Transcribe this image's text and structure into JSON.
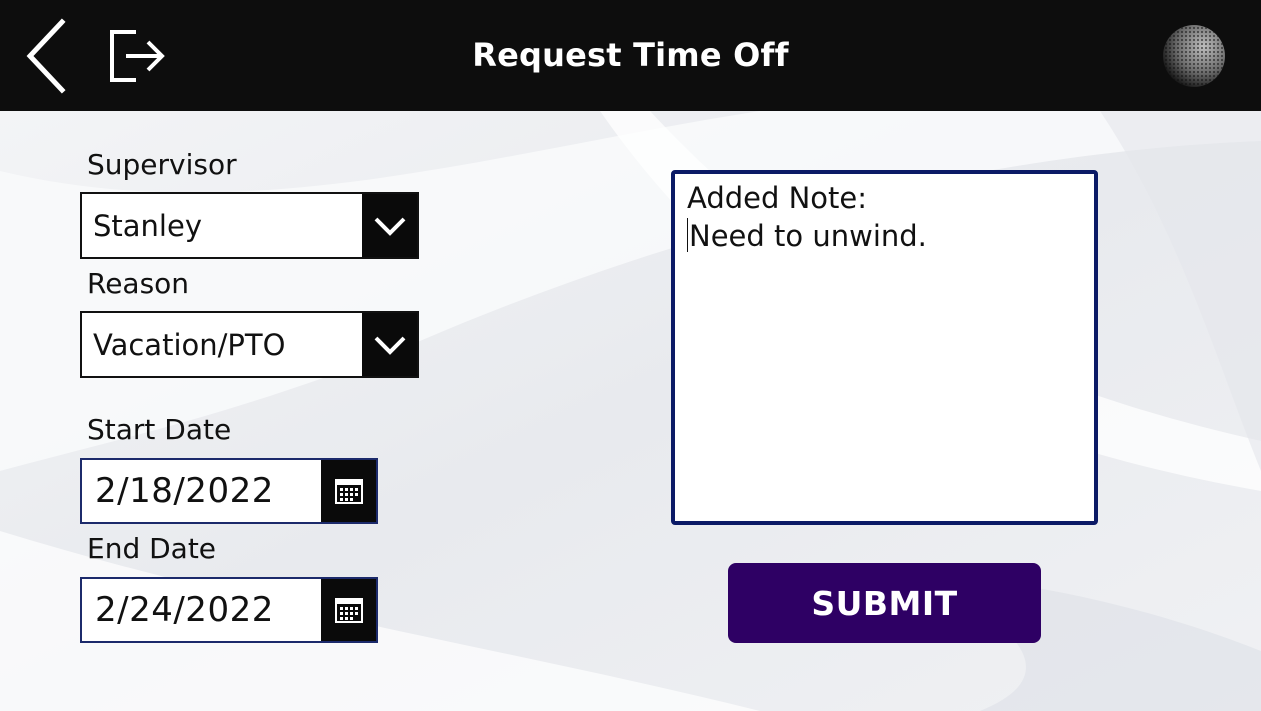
{
  "header": {
    "title": "Request Time Off",
    "back_icon": "back-arrow-icon",
    "exit_icon": "exit-icon",
    "logo_icon": "sphere-logo-icon"
  },
  "form": {
    "supervisor": {
      "label": "Supervisor",
      "value": "Stanley"
    },
    "reason": {
      "label": "Reason",
      "value": "Vacation/PTO"
    },
    "start_date": {
      "label": "Start Date",
      "value": "2/18/2022"
    },
    "end_date": {
      "label": "End Date",
      "value": "2/24/2022"
    },
    "note": {
      "line1": "Added Note:",
      "line2": "Need to unwind."
    },
    "submit_label": "SUBMIT"
  },
  "colors": {
    "header_bg": "#0d0d0d",
    "submit_bg": "#2e0064",
    "note_border": "#0b1a66"
  }
}
